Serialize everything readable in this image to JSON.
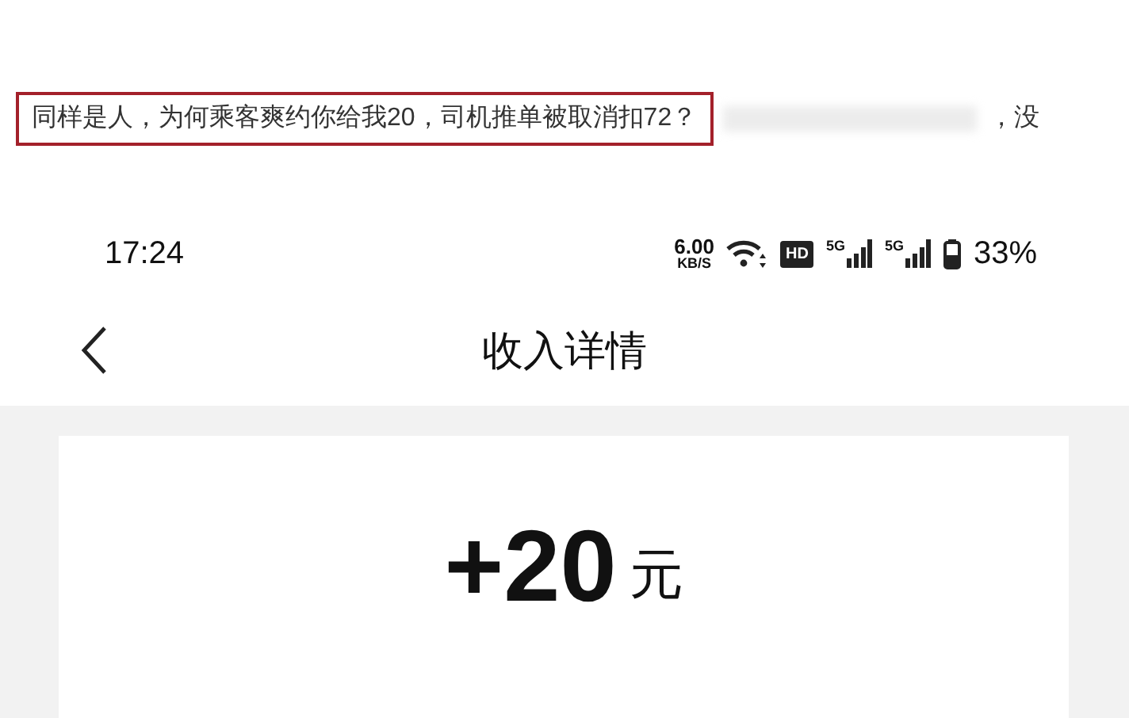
{
  "headline": {
    "text": "同样是人，为何乘客爽约你给我20，司机推单被取消扣72？",
    "trailing": "，没"
  },
  "status_bar": {
    "time": "17:24",
    "speed": "6.00",
    "speed_unit": "KB/S",
    "hd_label": "HD",
    "network_labels": [
      "5G",
      "5G"
    ],
    "battery": "33%"
  },
  "nav": {
    "title": "收入详情"
  },
  "income": {
    "amount": "+20",
    "unit": "元"
  }
}
